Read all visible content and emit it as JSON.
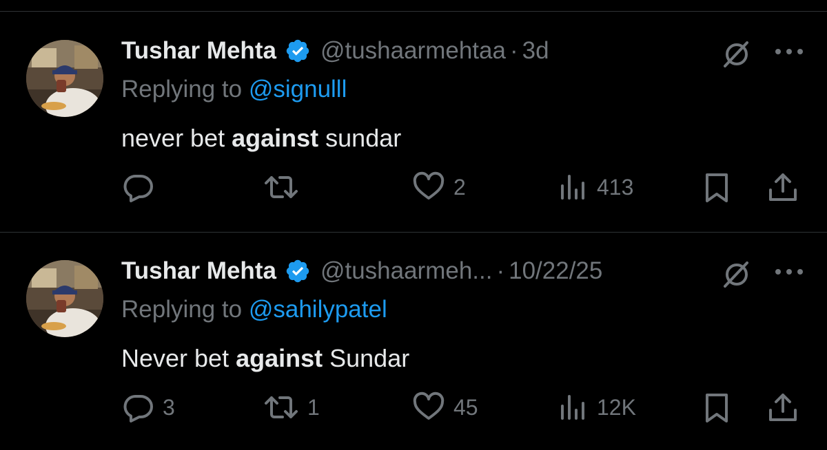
{
  "theme": {
    "background": "#000000",
    "text": "#e7e9ea",
    "secondary_text": "#71767b",
    "link": "#1d9bf0",
    "divider": "#2f3336",
    "verified_badge": "#1d9bf0"
  },
  "tweets": [
    {
      "display_name": "Tushar Mehta",
      "verified_icon": "verified-badge-icon",
      "handle": "@tushaarmehtaa",
      "separator": "·",
      "timestamp": "3d",
      "reply_prefix": "Replying to ",
      "reply_to": "@signulll",
      "text_before": "never bet ",
      "text_bold": "against",
      "text_after": " sundar",
      "actions": {
        "reply_count": "",
        "repost_count": "",
        "like_count": "2",
        "views_count": "413"
      }
    },
    {
      "display_name": "Tushar Mehta",
      "verified_icon": "verified-badge-icon",
      "handle": "@tushaarmeh...",
      "separator": "·",
      "timestamp": "10/22/25",
      "reply_prefix": "Replying to ",
      "reply_to": "@sahilypatel",
      "text_before": "Never bet ",
      "text_bold": "against",
      "text_after": " Sundar",
      "actions": {
        "reply_count": "3",
        "repost_count": "1",
        "like_count": "45",
        "views_count": "12K"
      }
    }
  ],
  "icons": {
    "reply": "reply-bubble-icon",
    "repost": "repost-icon",
    "like": "heart-icon",
    "views": "views-bars-icon",
    "bookmark": "bookmark-icon",
    "share": "share-upload-icon",
    "grok": "grok-icon",
    "more": "more-dots-icon"
  }
}
